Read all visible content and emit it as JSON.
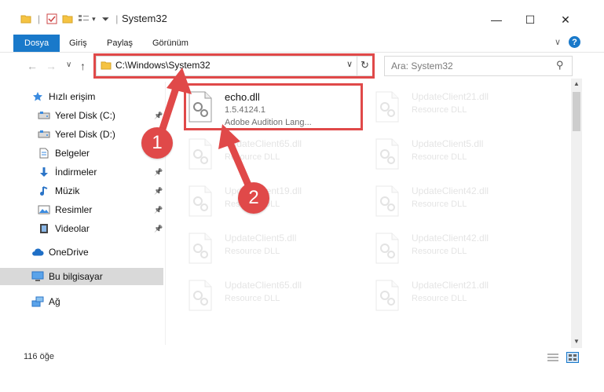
{
  "window": {
    "title": "System32",
    "controls": {
      "minimize": "—",
      "maximize": "☐",
      "close": "✕"
    }
  },
  "ribbon": {
    "tabs": [
      "Dosya",
      "Giriş",
      "Paylaş",
      "Görünüm"
    ],
    "active_tab": "Dosya"
  },
  "address_bar": {
    "path": "C:\\Windows\\System32"
  },
  "search": {
    "placeholder": "Ara: System32"
  },
  "sidebar": {
    "items": [
      {
        "label": "Hızlı erişim",
        "icon": "star-icon",
        "pinned": false
      },
      {
        "label": "Yerel Disk (C:)",
        "icon": "drive-icon",
        "pinned": true
      },
      {
        "label": "Yerel Disk (D:)",
        "icon": "drive-icon",
        "pinned": true
      },
      {
        "label": "Belgeler",
        "icon": "document-icon",
        "pinned": true
      },
      {
        "label": "İndirmeler",
        "icon": "download-icon",
        "pinned": true
      },
      {
        "label": "Müzik",
        "icon": "music-icon",
        "pinned": true
      },
      {
        "label": "Resimler",
        "icon": "pictures-icon",
        "pinned": true
      },
      {
        "label": "Videolar",
        "icon": "video-icon",
        "pinned": true
      },
      {
        "label": "OneDrive",
        "icon": "cloud-icon",
        "pinned": false
      },
      {
        "label": "Bu bilgisayar",
        "icon": "computer-icon",
        "pinned": false,
        "selected": true
      },
      {
        "label": "Ağ",
        "icon": "network-icon",
        "pinned": false
      }
    ]
  },
  "files": {
    "highlighted": {
      "name": "echo.dll",
      "version": "1.5.4124.1",
      "description": "Adobe Audition Lang..."
    },
    "ghost": [
      {
        "name": "UpdateClient21.dll",
        "type": "Resource DLL"
      },
      {
        "name": "UpdateClient65.dll",
        "type": "Resource DLL"
      },
      {
        "name": "UpdateClient5.dll",
        "type": "Resource DLL"
      },
      {
        "name": "UpdateClient19.dll",
        "type": "Resource DLL"
      },
      {
        "name": "UpdateClient42.dll",
        "type": "Resource DLL"
      },
      {
        "name": "UpdateClient5.dll",
        "type": "Resource DLL"
      },
      {
        "name": "UpdateClient42.dll",
        "type": "Resource DLL"
      },
      {
        "name": "UpdateClient65.dll",
        "type": "Resource DLL"
      },
      {
        "name": "UpdateClient21.dll",
        "type": "Resource DLL"
      }
    ]
  },
  "status": {
    "count": "116 öğe"
  },
  "annotations": {
    "step1": "1",
    "step2": "2"
  },
  "colors": {
    "accent": "#1979ca",
    "annotation": "#e04949",
    "selection": "#d9d9d9"
  }
}
